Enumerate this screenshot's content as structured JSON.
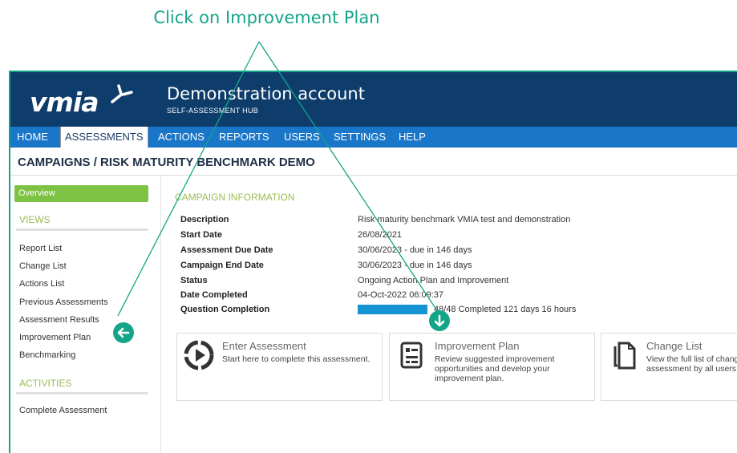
{
  "callout": "Click on Improvement Plan",
  "header": {
    "logo": "vmia",
    "account_title": "Demonstration account",
    "account_subtitle": "SELF-ASSESSMENT HUB"
  },
  "nav": [
    "HOME",
    "ASSESSMENTS",
    "ACTIONS",
    "REPORTS",
    "USERS",
    "SETTINGS",
    "HELP"
  ],
  "breadcrumb": "CAMPAIGNS / RISK MATURITY BENCHMARK DEMO",
  "sidebar": {
    "overview": "Overview",
    "views_heading": "VIEWS",
    "views": [
      "Report List",
      "Change List",
      "Actions List",
      "Previous Assessments",
      "Assessment Results",
      "Improvement Plan",
      "Benchmarking"
    ],
    "activities_heading": "ACTIVITIES",
    "activities": [
      "Complete Assessment"
    ]
  },
  "campaign": {
    "section_title": "CAMPAIGN INFORMATION",
    "rows": [
      {
        "label": "Description",
        "value": "Risk maturity benchmark VMIA test and demonstration"
      },
      {
        "label": "Start Date",
        "value": "26/08/2021"
      },
      {
        "label": "Assessment Due Date",
        "value": "30/06/2023 - due in 146 days"
      },
      {
        "label": "Campaign End Date",
        "value": "30/06/2023 - due in 146 days"
      },
      {
        "label": "Status",
        "value": "Ongoing Action Plan and Improvement"
      },
      {
        "label": "Date Completed",
        "value": "04-Oct-2022 06:09:37"
      },
      {
        "label": "Question Completion",
        "value": "48/48 Completed 121 days 16 hours"
      }
    ],
    "progress_fraction": 1.0
  },
  "cards": [
    {
      "title": "Enter Assessment",
      "desc": "Start here to complete this assessment.",
      "icon": "play-icon"
    },
    {
      "title": "Improvement Plan",
      "desc": "Review suggested improvement opportunities and develop your improvement plan.",
      "icon": "document-icon"
    },
    {
      "title": "Change List",
      "desc": "View the full list of changes made to this assessment by all users.",
      "icon": "copy-icon"
    }
  ],
  "colors": {
    "accent": "#13a589",
    "header": "#0e3d6b",
    "nav": "#1976c8",
    "overview": "#7dc242",
    "heading": "#9bbd55",
    "progress": "#1593d2"
  }
}
